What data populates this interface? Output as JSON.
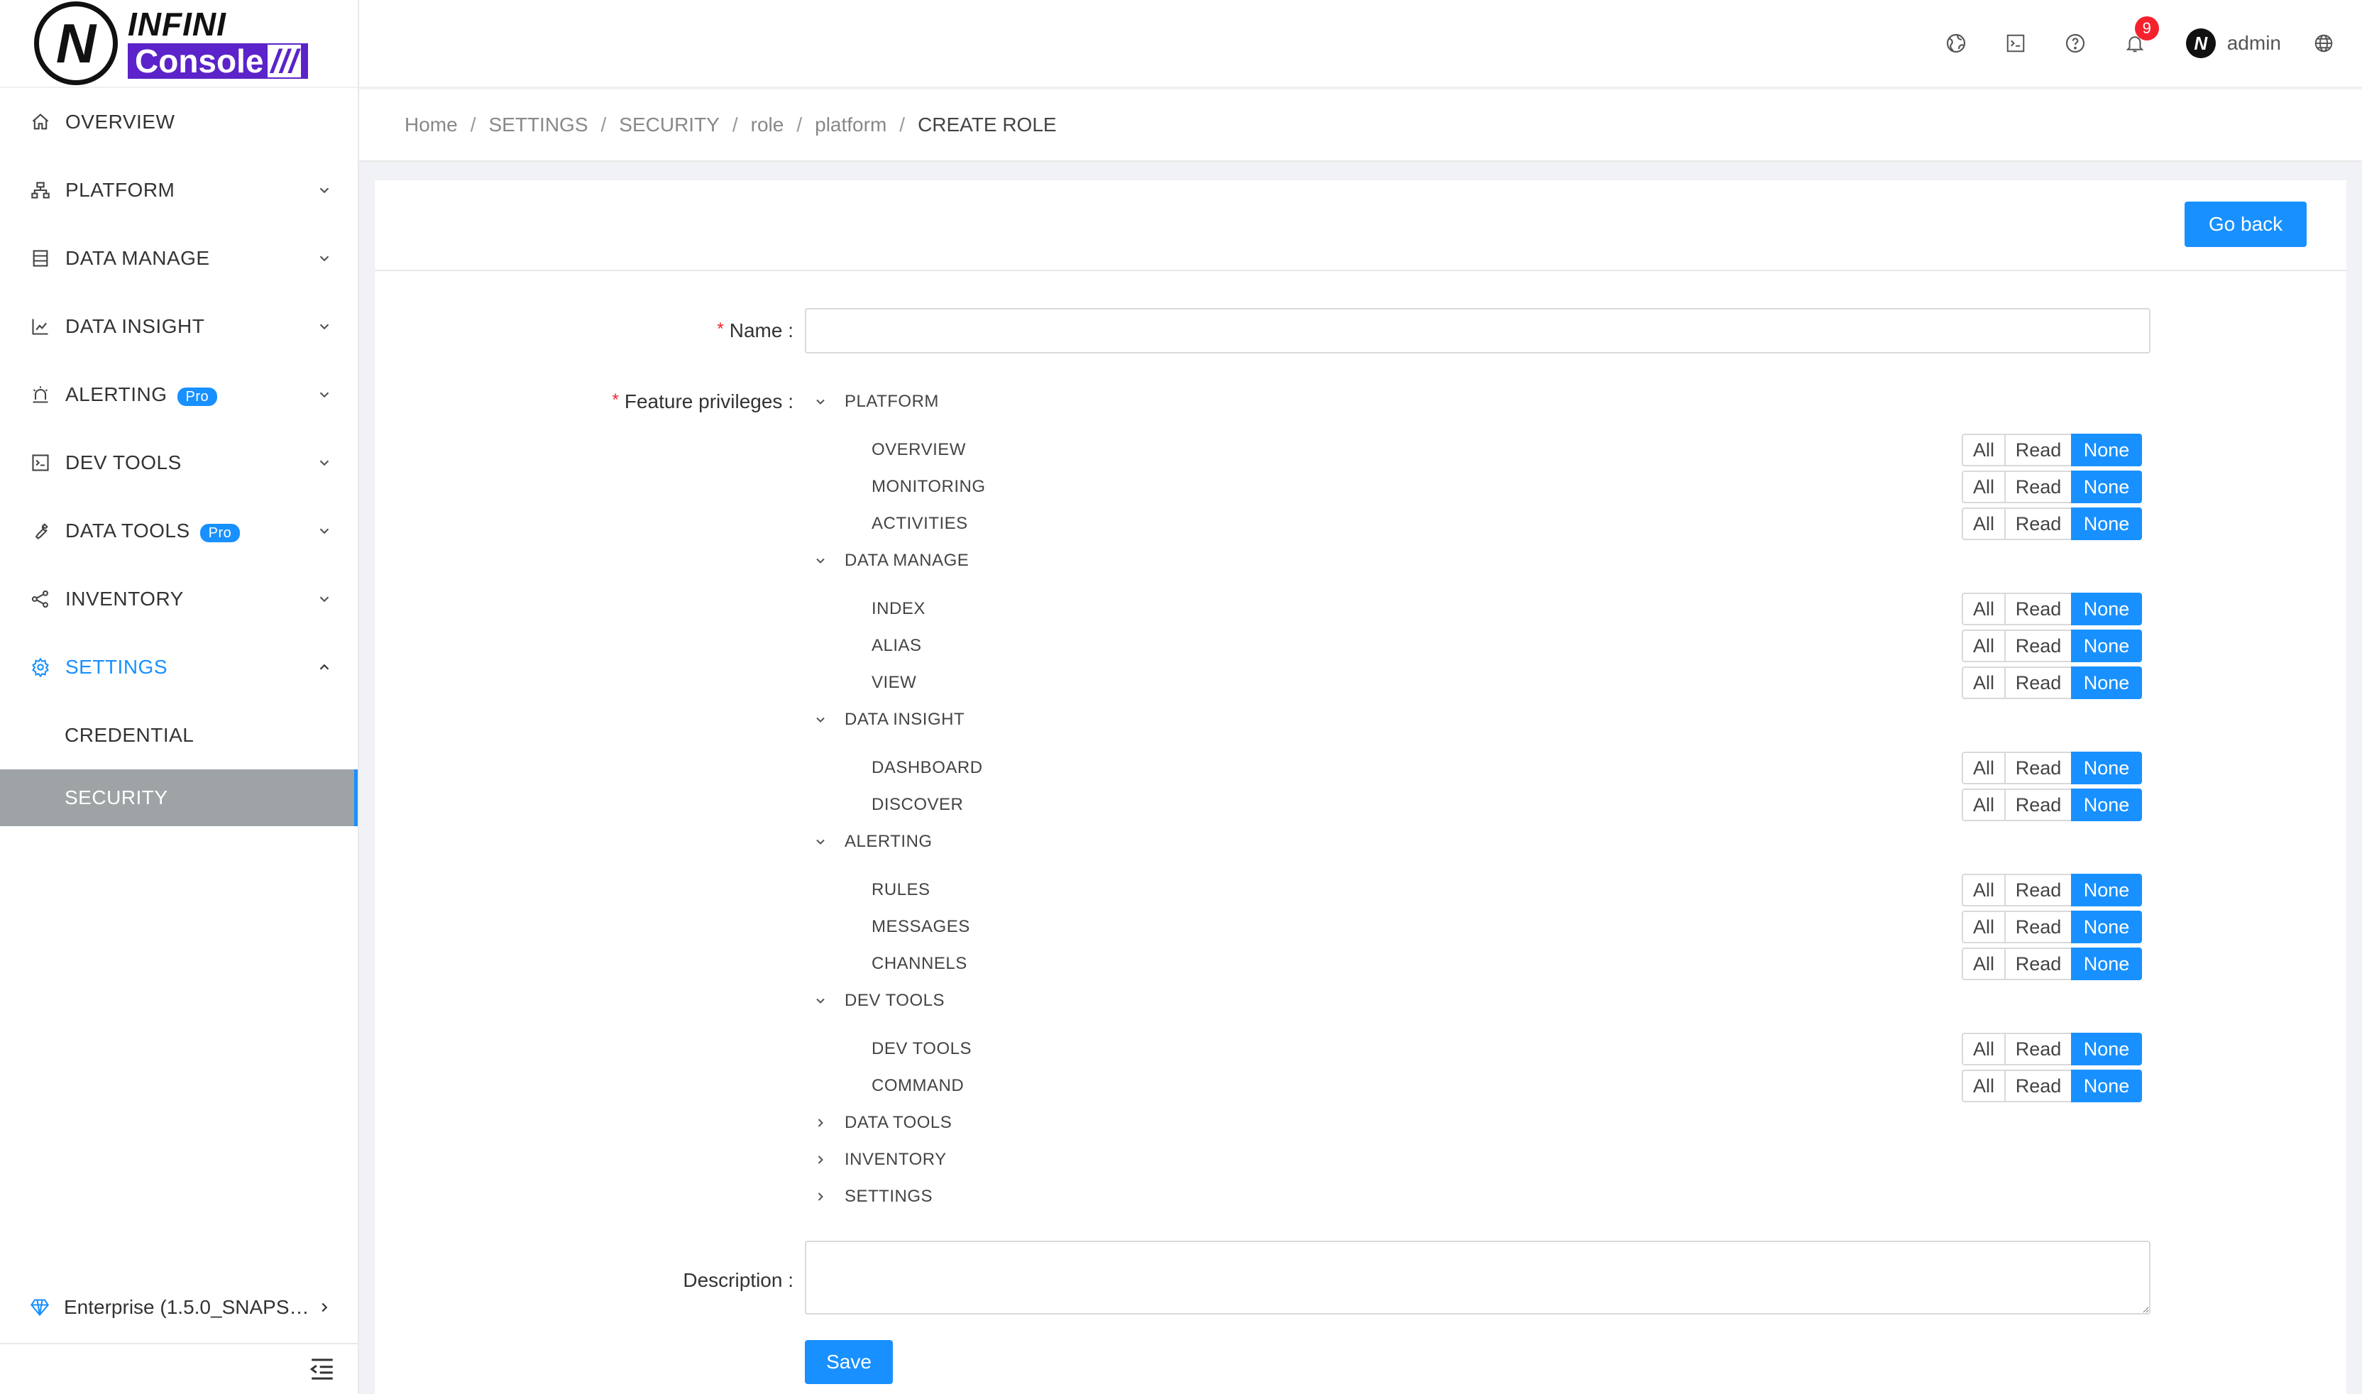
{
  "brand": {
    "line1": "INFINI",
    "line2": "Console",
    "slashes": "///",
    "mark": "N"
  },
  "sidebar": {
    "items": [
      {
        "label": "OVERVIEW"
      },
      {
        "label": "PLATFORM"
      },
      {
        "label": "DATA MANAGE"
      },
      {
        "label": "DATA INSIGHT"
      },
      {
        "label": "ALERTING",
        "badge": "Pro"
      },
      {
        "label": "DEV TOOLS"
      },
      {
        "label": "DATA TOOLS",
        "badge": "Pro"
      },
      {
        "label": "INVENTORY"
      },
      {
        "label": "SETTINGS"
      }
    ],
    "sub_items": [
      {
        "label": "CREDENTIAL"
      },
      {
        "label": "SECURITY"
      }
    ],
    "footer": "Enterprise (1.5.0_SNAPSHOT)"
  },
  "header": {
    "notification_count": "9",
    "user_name": "admin"
  },
  "breadcrumb": [
    "Home",
    "SETTINGS",
    "SECURITY",
    "role",
    "platform",
    "CREATE ROLE"
  ],
  "breadcrumb_sep": "/",
  "actions": {
    "go_back": "Go back",
    "save": "Save"
  },
  "form": {
    "name_label": "Name",
    "name_value": "",
    "feature_label": "Feature privileges",
    "description_label": "Description",
    "description_value": "",
    "colon": ":",
    "required_mark": "*"
  },
  "privilege_options": {
    "all": "All",
    "read": "Read",
    "none": "None",
    "selected": "None"
  },
  "privileges": [
    {
      "group": "PLATFORM",
      "expanded": true,
      "items": [
        "OVERVIEW",
        "MONITORING",
        "ACTIVITIES"
      ]
    },
    {
      "group": "DATA MANAGE",
      "expanded": true,
      "items": [
        "INDEX",
        "ALIAS",
        "VIEW"
      ]
    },
    {
      "group": "DATA INSIGHT",
      "expanded": true,
      "items": [
        "DASHBOARD",
        "DISCOVER"
      ]
    },
    {
      "group": "ALERTING",
      "expanded": true,
      "items": [
        "RULES",
        "MESSAGES",
        "CHANNELS"
      ]
    },
    {
      "group": "DEV TOOLS",
      "expanded": true,
      "items": [
        "DEV TOOLS",
        "COMMAND"
      ]
    },
    {
      "group": "DATA TOOLS",
      "expanded": false,
      "items": []
    },
    {
      "group": "INVENTORY",
      "expanded": false,
      "items": []
    },
    {
      "group": "SETTINGS",
      "expanded": false,
      "items": []
    }
  ],
  "colors": {
    "accent": "#1890ff",
    "brand": "#5b23c9",
    "selected_bg": "#9ea3a6",
    "badge": "#f5222d"
  }
}
